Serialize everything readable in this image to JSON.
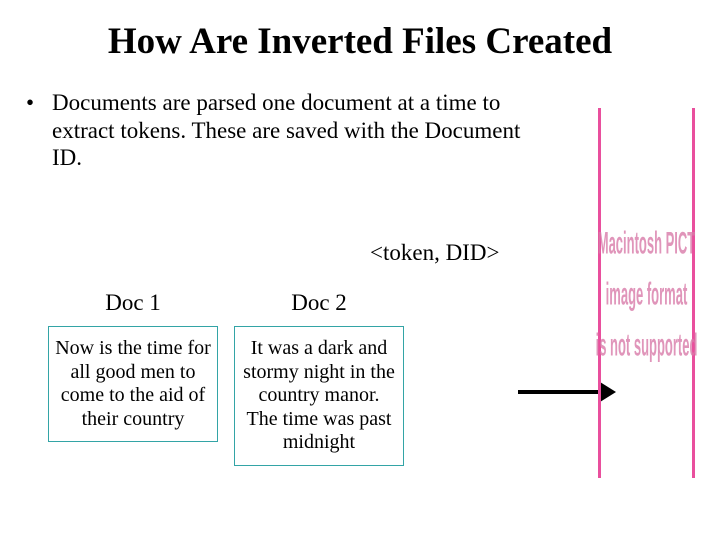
{
  "title": "How Are Inverted Files Created",
  "bullet": "Documents are parsed one document at a time to extract tokens. These are saved with the Document ID.",
  "token_pair": "<token, DID>",
  "docs": [
    {
      "label": "Doc 1",
      "text": "Now is the time for all good men to come to the aid of their country"
    },
    {
      "label": "Doc 2",
      "text": "It was a dark and stormy night in the country manor. The time was past midnight"
    }
  ],
  "right_panel": {
    "line1": "Macintosh PICT",
    "line2": "image format",
    "line3": "is not supported"
  }
}
